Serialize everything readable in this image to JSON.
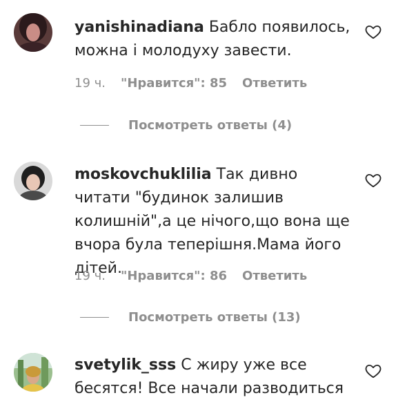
{
  "comments": [
    {
      "username": "yanishinadiana",
      "text": "Бабло появилось, можна і молодуху завести.",
      "time": "19 ч.",
      "likes": "\"Нравится\": 85",
      "reply_label": "Ответить",
      "view_replies": "Посмотреть ответы (4)"
    },
    {
      "username": "moskovchuklilia",
      "text": "Так дивно читати \"будинок залишив колишній\",а це нічого,що вона ще вчора була теперішня.Мама його дітей.",
      "time": "19 ч.",
      "likes": "\"Нравится\": 86",
      "reply_label": "Ответить",
      "view_replies": "Посмотреть ответы (13)"
    },
    {
      "username": "svetylik_sss",
      "text": "С жиру уже все бесятся! Все начали разводиться"
    }
  ],
  "icons": {
    "like": "heart-outline-icon"
  }
}
